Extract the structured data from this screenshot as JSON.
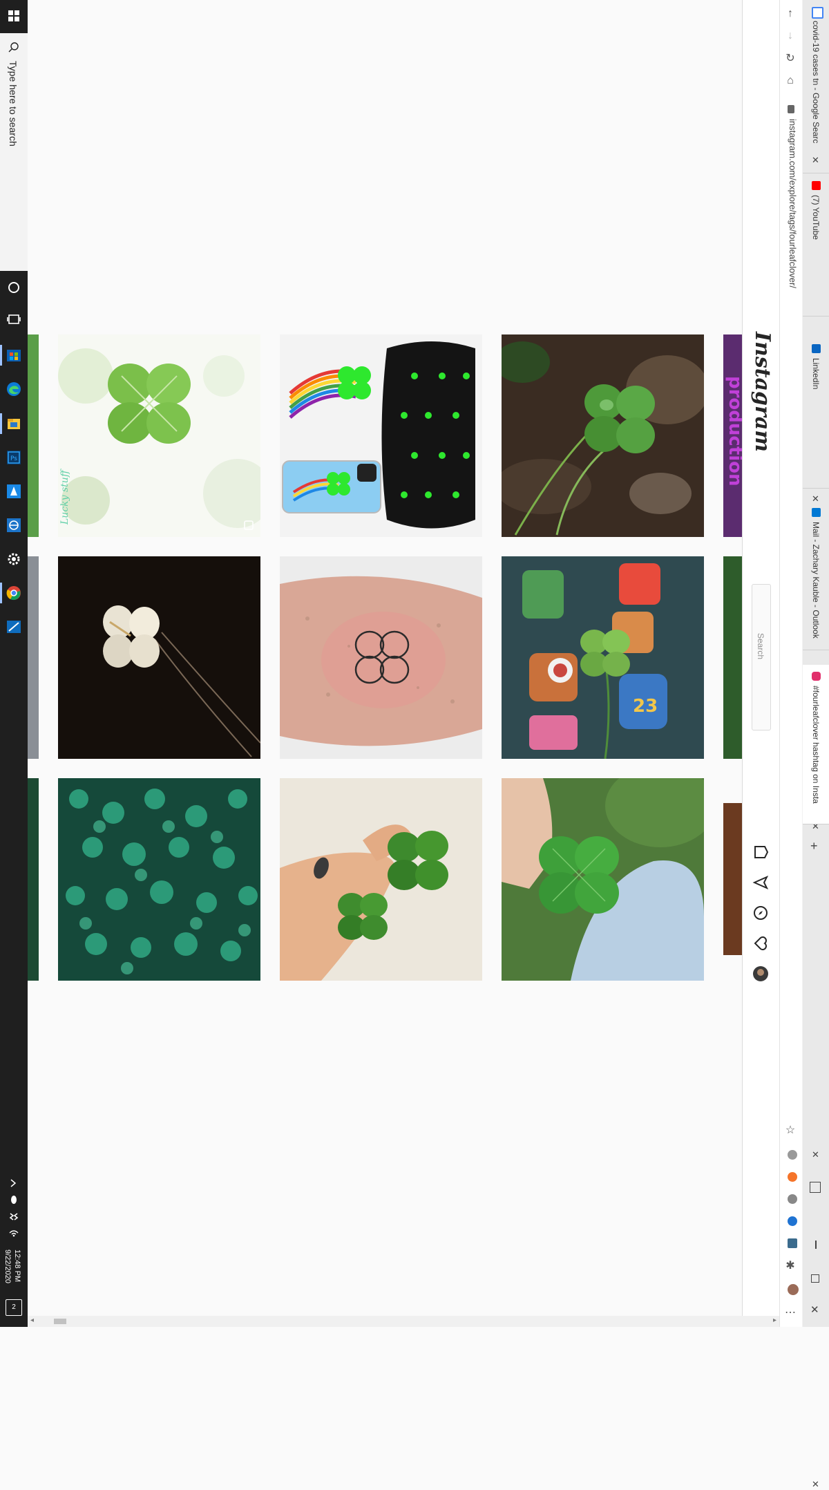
{
  "taskbar": {
    "search_placeholder": "Type here to search",
    "clock_time": "12:48 PM",
    "clock_date": "9/22/2020",
    "notification_count": "2",
    "pinned_apps": [
      "cortana-icon",
      "task-view-icon",
      "microsoft-store-icon",
      "edge-icon",
      "file-explorer-icon",
      "photoshop-icon",
      "azure-icon",
      "network-icon",
      "settings-icon",
      "chrome-icon",
      "remote-desktop-icon"
    ]
  },
  "browser": {
    "address": "instagram.com/explore/tags/fourleafclover/",
    "tabs": [
      {
        "title": "covid-19 cases tn - Google Searc",
        "favicon": "google-icon",
        "color": "#4285f4"
      },
      {
        "title": "(7) YouTube",
        "favicon": "youtube-icon",
        "color": "#ff0000"
      },
      {
        "title": "LinkedIn",
        "favicon": "linkedin-icon",
        "color": "#0a66c2"
      },
      {
        "title": "Mail - Zachary Kauble - Outlook",
        "favicon": "outlook-icon",
        "color": "#0078d4"
      },
      {
        "title": "#fourleafclover hashtag on Insta",
        "favicon": "instagram-icon",
        "color": "#e1306c"
      }
    ],
    "new_tab_symbol": "+"
  },
  "instagram": {
    "logo": "Instagram",
    "search_placeholder": "Search",
    "edge_banner_text": "production"
  },
  "photos": [
    {
      "id": "clover-white-bokeh",
      "caption": "Lucky stuff"
    },
    {
      "id": "rainbow-clover-merch"
    },
    {
      "id": "clover-on-dirt"
    },
    {
      "id": "silver-clover-pendant"
    },
    {
      "id": "clover-tattoo"
    },
    {
      "id": "clover-with-enamel-pins",
      "badge": "23"
    },
    {
      "id": "clover-patch"
    },
    {
      "id": "two-clovers-in-hand"
    },
    {
      "id": "clover-held-over-jeans"
    }
  ]
}
